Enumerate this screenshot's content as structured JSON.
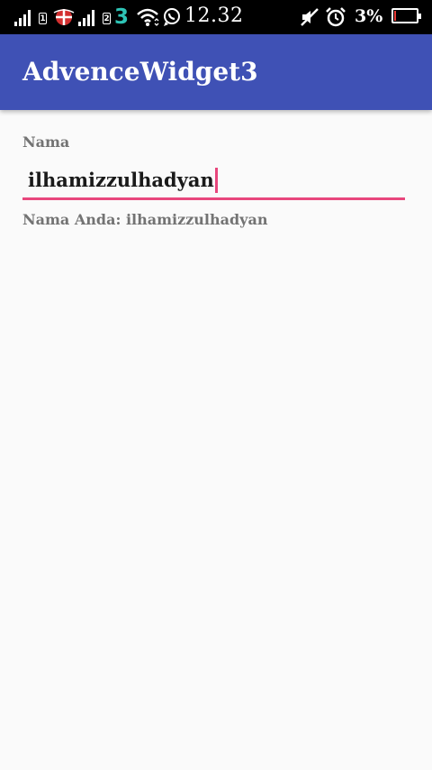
{
  "status_bar": {
    "sim1_label": "1",
    "sim2_label": "2",
    "carrier_label": "3",
    "time": "12.32",
    "battery_percent": "3%",
    "battery_level": 0.03,
    "icons": [
      "signal-icon",
      "signal-icon",
      "carrier-logo-icon",
      "wifi-icon",
      "whatsapp-icon",
      "mute-icon",
      "alarm-icon",
      "battery-icon"
    ],
    "battery_color": "#e53935"
  },
  "app_bar": {
    "title": "AdvenceWidget3",
    "color": "#3f51b5"
  },
  "form": {
    "field_label": "Nama",
    "input_value": "ilhamizzulhadyan",
    "accent_color": "#e8467c",
    "result_text": "Nama Anda: ilhamizzulhadyan"
  }
}
